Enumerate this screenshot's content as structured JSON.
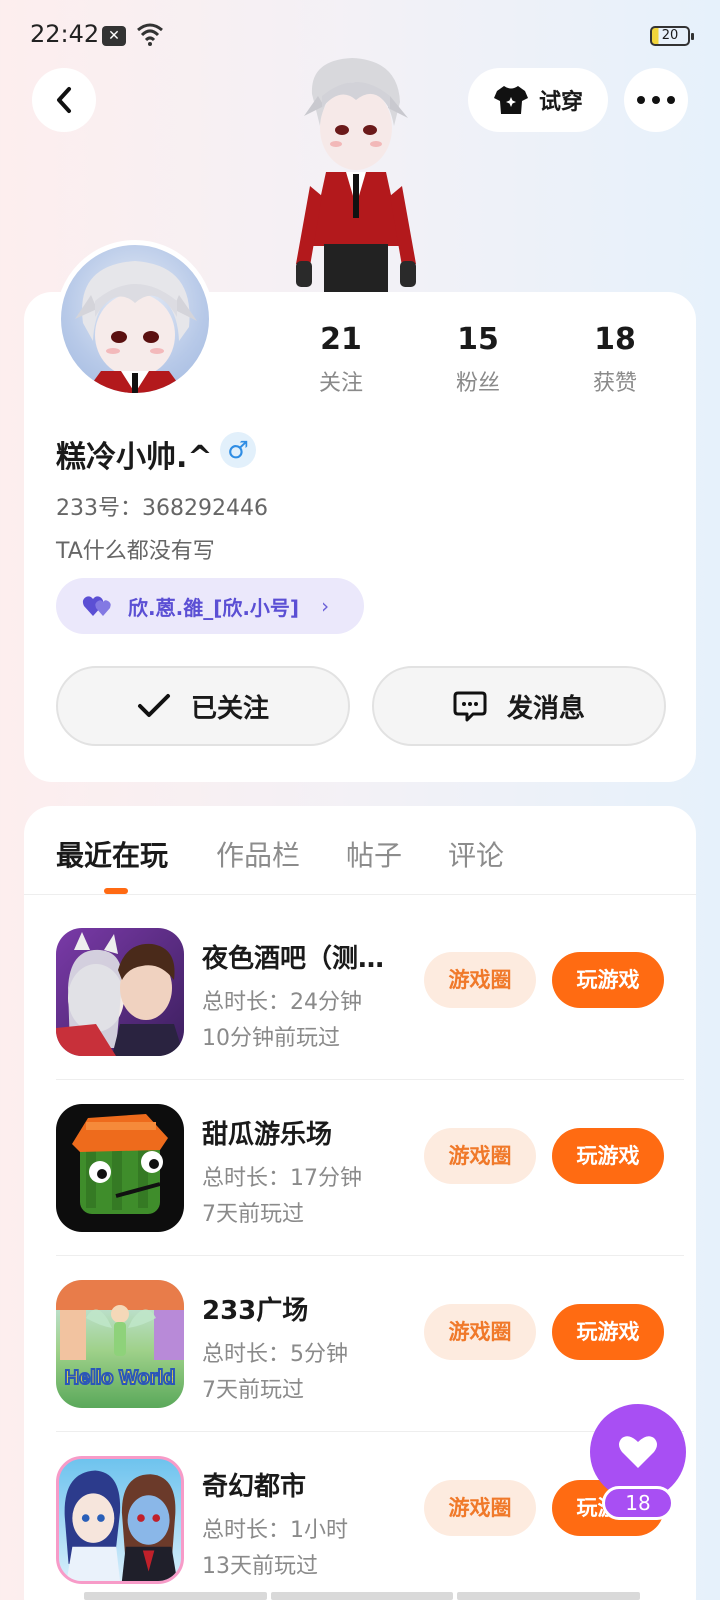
{
  "status": {
    "time": "22:42",
    "battery": "20"
  },
  "header": {
    "tryon_label": "试穿"
  },
  "stats": [
    {
      "num": "21",
      "label": "关注"
    },
    {
      "num": "15",
      "label": "粉丝"
    },
    {
      "num": "18",
      "label": "获赞"
    }
  ],
  "profile": {
    "name": "糕冷小帅.^",
    "gender_symbol": "♂",
    "uid": "233号：368292446",
    "bio": "TA什么都没有写",
    "relation": "欣.蒽.雒_[欣.小号]"
  },
  "actions": {
    "follow": "已关注",
    "message": "发消息"
  },
  "tabs": [
    "最近在玩",
    "作品栏",
    "帖子",
    "评论"
  ],
  "games": [
    {
      "title": "夜色酒吧（测…",
      "duration": "总时长：24分钟",
      "last": "10分钟前玩过",
      "circle": "游戏圈",
      "play": "玩游戏"
    },
    {
      "title": "甜瓜游乐场",
      "duration": "总时长：17分钟",
      "last": "7天前玩过",
      "circle": "游戏圈",
      "play": "玩游戏"
    },
    {
      "title": "233广场",
      "duration": "总时长：5分钟",
      "last": "7天前玩过",
      "circle": "游戏圈",
      "play": "玩游戏",
      "icon_text": "Hello World"
    },
    {
      "title": "奇幻都市",
      "duration": "总时长：1小时",
      "last": "13天前玩过",
      "circle": "游戏圈",
      "play": "玩游戏"
    }
  ],
  "likes": {
    "count": "18"
  },
  "colors": {
    "accent": "#ff6b12",
    "accent_soft": "#fdebdf",
    "purple": "#a84ff3",
    "relation_bg": "#ebe8fb"
  }
}
